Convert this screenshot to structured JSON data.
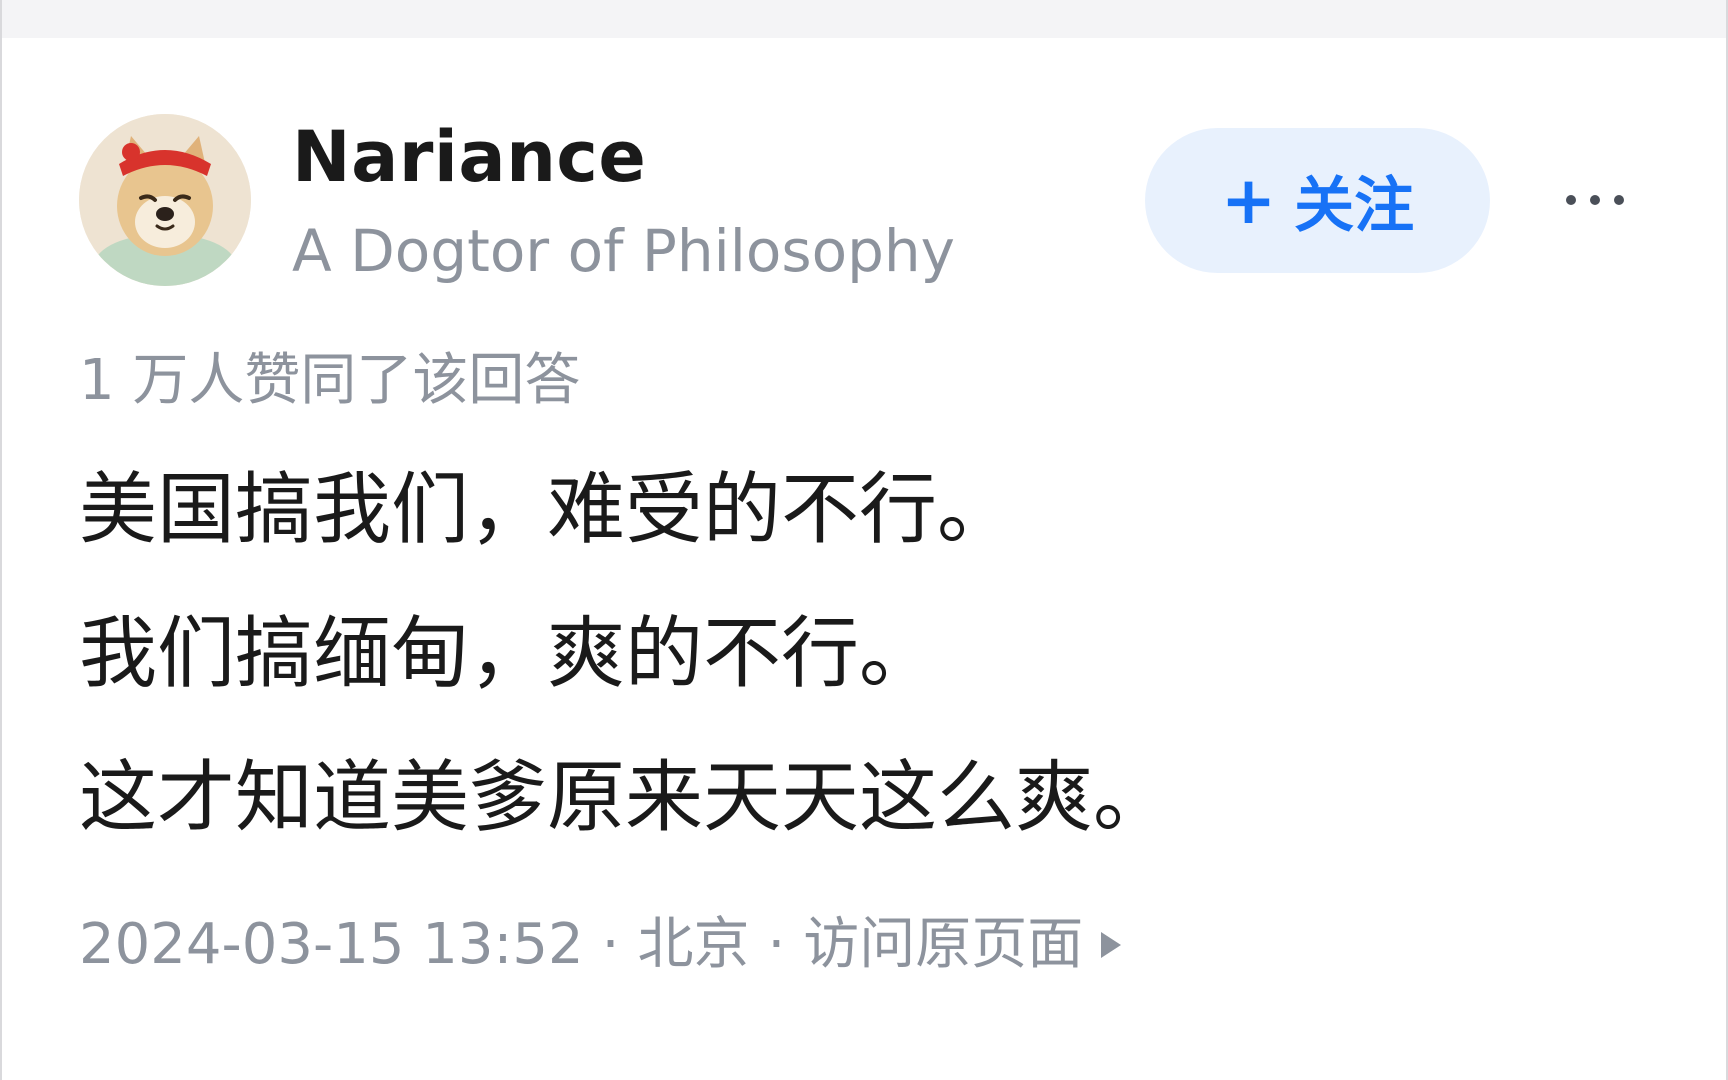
{
  "author": {
    "name": "Nariance",
    "bio": "A Dogtor of Philosophy",
    "avatar_icon": "shiba-dog-avatar"
  },
  "follow": {
    "plus_icon": "+",
    "label": "关注",
    "color": "#1772f6",
    "background": "#e8f1fd"
  },
  "more_icon": "more-horizontal-icon",
  "vote_text": "1 万人赞同了该回答",
  "content": {
    "lines": [
      "美国搞我们，难受的不行。",
      "我们搞缅甸，爽的不行。",
      "这才知道美爹原来天天这么爽。"
    ]
  },
  "meta": {
    "datetime": "2024-03-15 13:52",
    "separator": "·",
    "location": "北京",
    "view_original": "访问原页面"
  }
}
